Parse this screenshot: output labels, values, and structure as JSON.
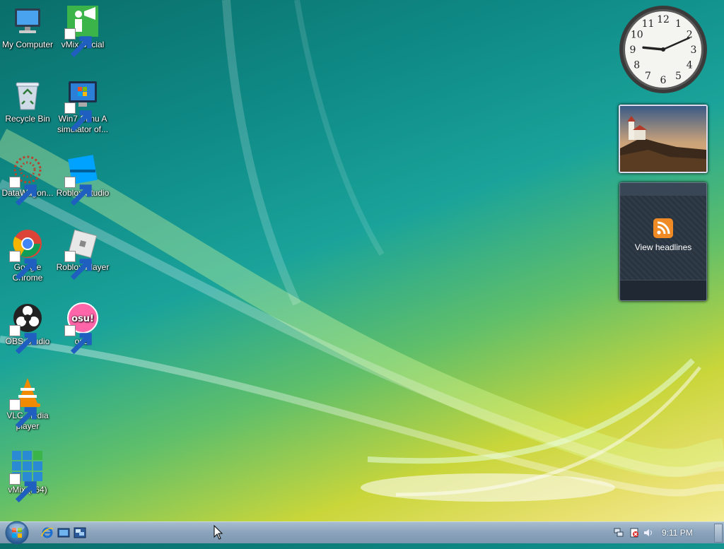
{
  "desktop_icons": [
    {
      "label": "My Computer",
      "icon": "computer-icon",
      "shortcut": false
    },
    {
      "label": "vMix Social",
      "icon": "vmix-social-icon",
      "shortcut": true
    },
    {
      "label": "Recycle Bin",
      "icon": "recycle-bin-icon",
      "shortcut": false
    },
    {
      "label": "Win7 Simu   A simulator of...",
      "icon": "win7-simu-icon",
      "shortcut": true
    },
    {
      "label": "DataWagon...",
      "icon": "datawagon-icon",
      "shortcut": true
    },
    {
      "label": "Roblox Studio",
      "icon": "roblox-studio-icon",
      "shortcut": true
    },
    {
      "label": "Google Chrome",
      "icon": "chrome-icon",
      "shortcut": true
    },
    {
      "label": "Roblox Player",
      "icon": "roblox-player-icon",
      "shortcut": true
    },
    {
      "label": "OBS Studio",
      "icon": "obs-icon",
      "shortcut": true
    },
    {
      "label": "osu!",
      "icon": "osu-icon",
      "shortcut": true
    },
    {
      "label": "VLC media player",
      "icon": "vlc-icon",
      "shortcut": true
    },
    {
      "label": "vMix (x64)",
      "icon": "vmix-icon",
      "shortcut": true
    }
  ],
  "gadgets": {
    "clock": {
      "hour": 9,
      "minute": 11,
      "numerals": [
        "12",
        "1",
        "2",
        "3",
        "4",
        "5",
        "6",
        "7",
        "8",
        "9",
        "10",
        "11"
      ]
    },
    "slideshow": {
      "icon": "lighthouse-photo"
    },
    "feed_headlines": {
      "label": "View headlines",
      "icon": "rss-icon"
    }
  },
  "taskbar": {
    "start": "start-orb-icon",
    "quick_launch": [
      "ie-icon",
      "show-desktop-icon",
      "switch-windows-icon"
    ],
    "tray_icons": [
      "network-icon",
      "action-center-icon",
      "volume-icon"
    ],
    "time": "9:11 PM"
  },
  "colors": {
    "taskbar": "#8aa3bb",
    "gadget_dark": "#2a3440",
    "accent": "#f08a24"
  }
}
